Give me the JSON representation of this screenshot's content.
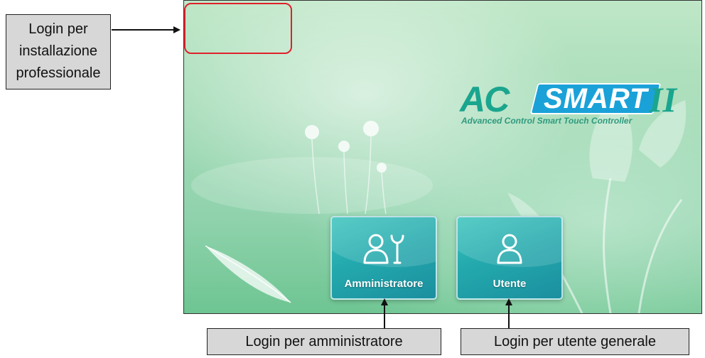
{
  "callouts": {
    "install_lines": [
      "Login per",
      "installazione",
      "professionale"
    ],
    "admin": "Login per amministratore",
    "user": "Login per utente generale"
  },
  "logo": {
    "ac": "AC",
    "smart": "SMART",
    "version": "II",
    "tagline": "Advanced Control Smart Touch Controller"
  },
  "tiles": {
    "admin": {
      "label": "Amministratore",
      "icon": "admin-user-wrench-icon"
    },
    "user": {
      "label": "Utente",
      "icon": "user-icon"
    }
  },
  "colors": {
    "highlight": "#e0202a",
    "brand_green": "#1aa58e",
    "brand_blue": "#1aa2d8",
    "tile": "#23a9ad"
  }
}
